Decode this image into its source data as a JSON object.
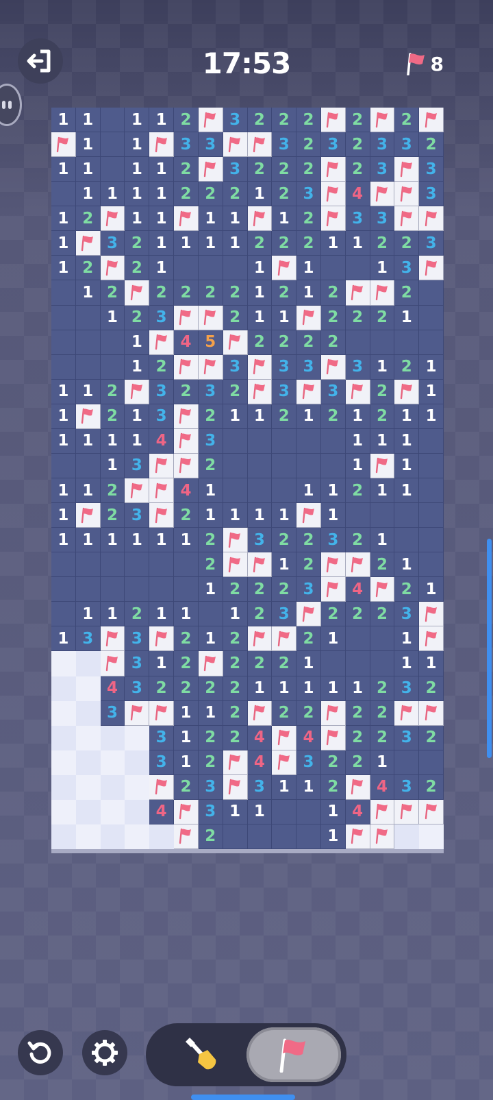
{
  "header": {
    "timer": "17:53",
    "flags_remaining": "8",
    "exit_icon": "exit-icon",
    "flag_icon": "flag-icon"
  },
  "board": {
    "columns": 16,
    "legend": "digits = revealed numbers, F = flag, # = covered tile, . = empty revealed",
    "rows": [
      "11.112F3222F2F2FF",
      "F1.1F33FF3232332",
      "11.112F3222F23F31",
      ".111122212 3F4FF3",
      "12F11F11F12F33FF",
      "1F3211112221 1 2232",
      "12F21...1F1..13F2.",
      ".12F22221212FF2.",
      "..123FF2 11F2221.",
      "...1F45F2222....",
      "...12FF3F33F3 1211",
      "112F323 2F3F3F2F1",
      "1F213F2112121211",
      "11114F3.....111..",
      "..13FF2.....1F1..",
      "112FF41...112 11..",
      "1F23F2 1111F1....",
      "1111112F3223 21..",
      "......2FF12FF21.",
      "......1222 3F4F21",
      ".1121 1.123F2223F",
      "13F3F212FF21..1F2",
      "##F312F22 21...111",
      "##432222111112 32",
      "##3FF112F22F22FFF",
      "####312 24F4F2232",
      "####312F4F3221..",
      "####F23F3112F432",
      "####4F311..14FFFF",
      "#####F2....1FF###"
    ]
  },
  "controls": {
    "undo_icon": "undo-icon",
    "settings_icon": "gear-icon",
    "dig_mode_icon": "shovel-icon",
    "flag_mode_icon": "flag-icon",
    "selected_mode": "flag"
  },
  "colors": {
    "background": "#5b5d80",
    "board": "#4f5b8c",
    "covered": "#eef0fa",
    "number_1": "#ffffff",
    "number_2": "#7fdca3",
    "number_3": "#43b3ea",
    "number_4": "#ef6585",
    "number_5": "#f4a04a",
    "flag": "#f06a86"
  }
}
